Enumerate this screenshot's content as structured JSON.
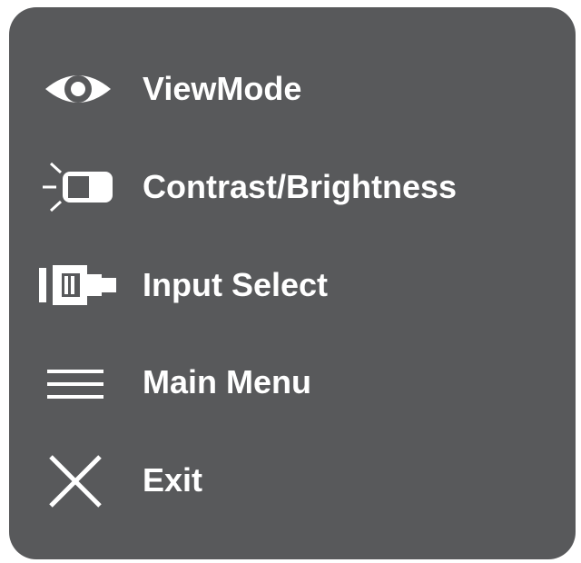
{
  "osd_menu": {
    "panel_color": "#58595b",
    "text_color": "#ffffff",
    "items": [
      {
        "label": "ViewMode",
        "icon": "eye-icon"
      },
      {
        "label": "Contrast/Brightness",
        "icon": "contrast-brightness-icon"
      },
      {
        "label": "Input Select",
        "icon": "input-connector-icon"
      },
      {
        "label": "Main Menu",
        "icon": "hamburger-menu-icon"
      },
      {
        "label": "Exit",
        "icon": "close-x-icon"
      }
    ]
  }
}
